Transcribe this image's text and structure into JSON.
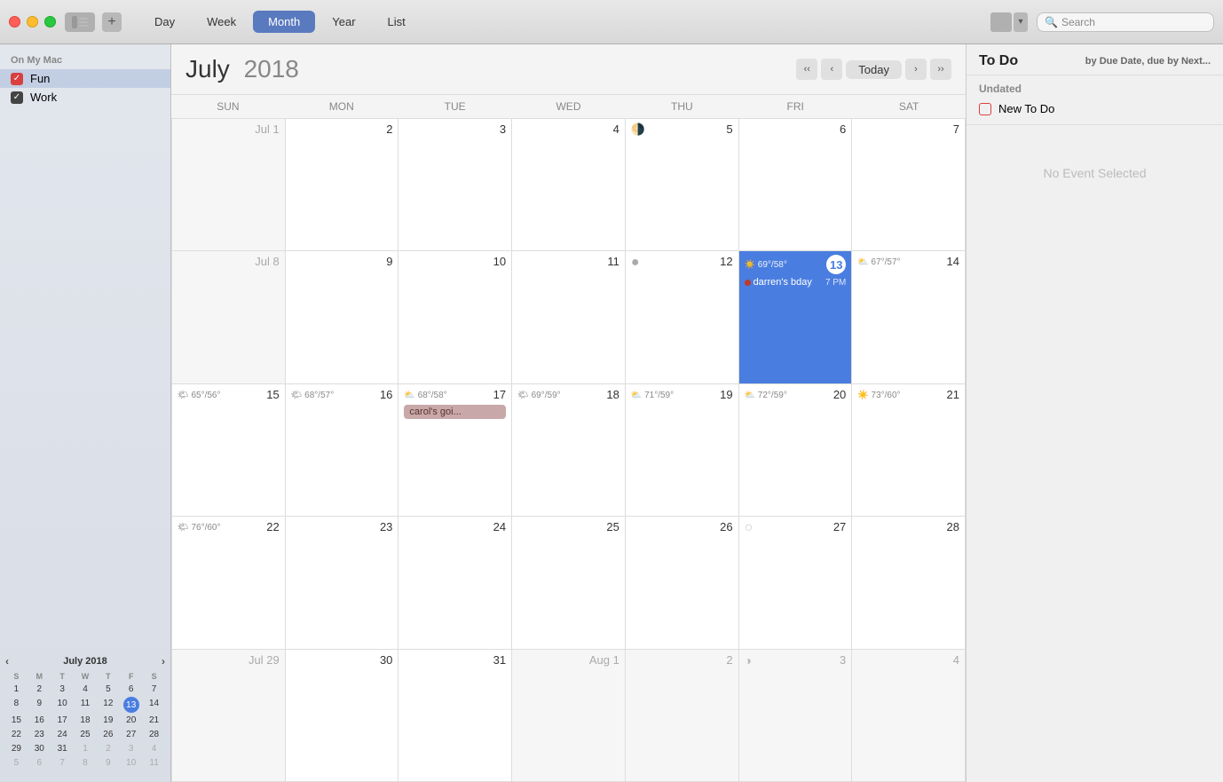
{
  "titlebar": {
    "nav_tabs": [
      "Day",
      "Week",
      "Month",
      "Year",
      "List"
    ],
    "active_tab": "Month",
    "search_placeholder": "Search"
  },
  "sidebar": {
    "section_label": "On My Mac",
    "calendars": [
      {
        "name": "Fun",
        "color": "#d94040",
        "checked": true
      },
      {
        "name": "Work",
        "color": "#444444",
        "checked": true
      }
    ]
  },
  "mini_cal": {
    "title": "July 2018",
    "dow": [
      "S",
      "M",
      "T",
      "W",
      "T",
      "F",
      "S"
    ],
    "weeks": [
      [
        {
          "day": "1",
          "other": false,
          "today": false
        },
        {
          "day": "2",
          "other": false,
          "today": false
        },
        {
          "day": "3",
          "other": false,
          "today": false
        },
        {
          "day": "4",
          "other": false,
          "today": false
        },
        {
          "day": "5",
          "other": false,
          "today": false
        },
        {
          "day": "6",
          "other": false,
          "today": false
        },
        {
          "day": "7",
          "other": false,
          "today": false
        }
      ],
      [
        {
          "day": "8",
          "other": false,
          "today": false
        },
        {
          "day": "9",
          "other": false,
          "today": false
        },
        {
          "day": "10",
          "other": false,
          "today": false
        },
        {
          "day": "11",
          "other": false,
          "today": false
        },
        {
          "day": "12",
          "other": false,
          "today": false
        },
        {
          "day": "13",
          "other": false,
          "today": true
        },
        {
          "day": "14",
          "other": false,
          "today": false
        }
      ],
      [
        {
          "day": "15",
          "other": false,
          "today": false
        },
        {
          "day": "16",
          "other": false,
          "today": false
        },
        {
          "day": "17",
          "other": false,
          "today": false
        },
        {
          "day": "18",
          "other": false,
          "today": false
        },
        {
          "day": "19",
          "other": false,
          "today": false
        },
        {
          "day": "20",
          "other": false,
          "today": false
        },
        {
          "day": "21",
          "other": false,
          "today": false
        }
      ],
      [
        {
          "day": "22",
          "other": false,
          "today": false
        },
        {
          "day": "23",
          "other": false,
          "today": false
        },
        {
          "day": "24",
          "other": false,
          "today": false
        },
        {
          "day": "25",
          "other": false,
          "today": false
        },
        {
          "day": "26",
          "other": false,
          "today": false
        },
        {
          "day": "27",
          "other": false,
          "today": false
        },
        {
          "day": "28",
          "other": false,
          "today": false
        }
      ],
      [
        {
          "day": "29",
          "other": false,
          "today": false
        },
        {
          "day": "30",
          "other": false,
          "today": false
        },
        {
          "day": "31",
          "other": false,
          "today": false
        },
        {
          "day": "1",
          "other": true,
          "today": false
        },
        {
          "day": "2",
          "other": true,
          "today": false
        },
        {
          "day": "3",
          "other": true,
          "today": false
        },
        {
          "day": "4",
          "other": true,
          "today": false
        }
      ],
      [
        {
          "day": "5",
          "other": true,
          "today": false
        },
        {
          "day": "6",
          "other": true,
          "today": false
        },
        {
          "day": "7",
          "other": true,
          "today": false
        },
        {
          "day": "8",
          "other": true,
          "today": false
        },
        {
          "day": "9",
          "other": true,
          "today": false
        },
        {
          "day": "10",
          "other": true,
          "today": false
        },
        {
          "day": "11",
          "other": true,
          "today": false
        }
      ]
    ]
  },
  "calendar": {
    "title_month": "July",
    "title_year": "2018",
    "dow": [
      "SUN",
      "MON",
      "TUE",
      "WED",
      "THU",
      "FRI",
      "SAT"
    ],
    "today_label": "Today",
    "rows": [
      [
        {
          "day": "Jul 1",
          "other": true,
          "today": false,
          "weather": null,
          "moon": null,
          "events": []
        },
        {
          "day": "2",
          "other": false,
          "today": false,
          "weather": null,
          "moon": null,
          "events": []
        },
        {
          "day": "3",
          "other": false,
          "today": false,
          "weather": null,
          "moon": null,
          "events": []
        },
        {
          "day": "4",
          "other": false,
          "today": false,
          "weather": null,
          "moon": null,
          "events": []
        },
        {
          "day": "5",
          "other": false,
          "today": false,
          "weather": null,
          "moon": "🌗",
          "events": []
        },
        {
          "day": "6",
          "other": false,
          "today": false,
          "weather": null,
          "moon": null,
          "events": []
        },
        {
          "day": "7",
          "other": false,
          "today": false,
          "weather": null,
          "moon": null,
          "events": []
        }
      ],
      [
        {
          "day": "Jul 8",
          "other": true,
          "today": false,
          "weather": null,
          "moon": null,
          "events": []
        },
        {
          "day": "9",
          "other": false,
          "today": false,
          "weather": null,
          "moon": null,
          "events": []
        },
        {
          "day": "10",
          "other": false,
          "today": false,
          "weather": null,
          "moon": null,
          "events": []
        },
        {
          "day": "11",
          "other": false,
          "today": false,
          "weather": null,
          "moon": null,
          "events": []
        },
        {
          "day": "12",
          "other": false,
          "today": false,
          "weather": null,
          "moon": "🌑",
          "events": []
        },
        {
          "day": "13",
          "other": false,
          "today": true,
          "weather": "☀️ 69°/58°",
          "moon": null,
          "events": [
            {
              "type": "dot",
              "label": "darren's bday",
              "time": "7 PM",
              "color": "#8b1a1a"
            }
          ]
        },
        {
          "day": "14",
          "other": false,
          "today": false,
          "weather": "⛅ 67°/57°",
          "moon": null,
          "events": []
        }
      ],
      [
        {
          "day": "15",
          "other": false,
          "today": false,
          "weather": "🌤 65°/56°",
          "moon": null,
          "events": []
        },
        {
          "day": "16",
          "other": false,
          "today": false,
          "weather": "🌤 68°/57°",
          "moon": null,
          "events": []
        },
        {
          "day": "17",
          "other": false,
          "today": false,
          "weather": "⛅ 68°/58°",
          "moon": null,
          "events": [
            {
              "type": "pill",
              "label": "carol's goi...",
              "color": "#c8a8a8"
            }
          ]
        },
        {
          "day": "18",
          "other": false,
          "today": false,
          "weather": "🌤 69°/59°",
          "moon": null,
          "events": []
        },
        {
          "day": "19",
          "other": false,
          "today": false,
          "weather": "⛅ 71°/59°",
          "moon": null,
          "events": []
        },
        {
          "day": "20",
          "other": false,
          "today": false,
          "weather": "⛅ 72°/59°",
          "moon": null,
          "events": []
        },
        {
          "day": "21",
          "other": false,
          "today": false,
          "weather": "☀️ 73°/60°",
          "moon": null,
          "events": []
        }
      ],
      [
        {
          "day": "22",
          "other": false,
          "today": false,
          "weather": "🌤 76°/60°",
          "moon": null,
          "events": []
        },
        {
          "day": "23",
          "other": false,
          "today": false,
          "weather": null,
          "moon": null,
          "events": []
        },
        {
          "day": "24",
          "other": false,
          "today": false,
          "weather": null,
          "moon": null,
          "events": []
        },
        {
          "day": "25",
          "other": false,
          "today": false,
          "weather": null,
          "moon": null,
          "events": []
        },
        {
          "day": "26",
          "other": false,
          "today": false,
          "weather": null,
          "moon": null,
          "events": []
        },
        {
          "day": "27",
          "other": false,
          "today": false,
          "weather": null,
          "moon": "🌑",
          "events": []
        },
        {
          "day": "28",
          "other": false,
          "today": false,
          "weather": null,
          "moon": null,
          "events": []
        }
      ],
      [
        {
          "day": "Jul 29",
          "other": true,
          "today": false,
          "weather": null,
          "moon": null,
          "events": []
        },
        {
          "day": "30",
          "other": false,
          "today": false,
          "weather": null,
          "moon": null,
          "events": []
        },
        {
          "day": "31",
          "other": false,
          "today": false,
          "weather": null,
          "moon": null,
          "events": []
        },
        {
          "day": "Aug 1",
          "other": true,
          "today": false,
          "weather": null,
          "moon": null,
          "events": []
        },
        {
          "day": "2",
          "other": true,
          "today": false,
          "weather": null,
          "moon": null,
          "events": []
        },
        {
          "day": "3",
          "other": true,
          "today": false,
          "weather": null,
          "moon": "🌗",
          "events": []
        },
        {
          "day": "4",
          "other": true,
          "today": false,
          "weather": null,
          "moon": null,
          "events": []
        }
      ]
    ]
  },
  "right_panel": {
    "title": "To Do",
    "sort_label": "by Due Date, due by Next...",
    "section_undated": "Undated",
    "new_todo_label": "New To Do",
    "no_event_label": "No Event Selected"
  }
}
